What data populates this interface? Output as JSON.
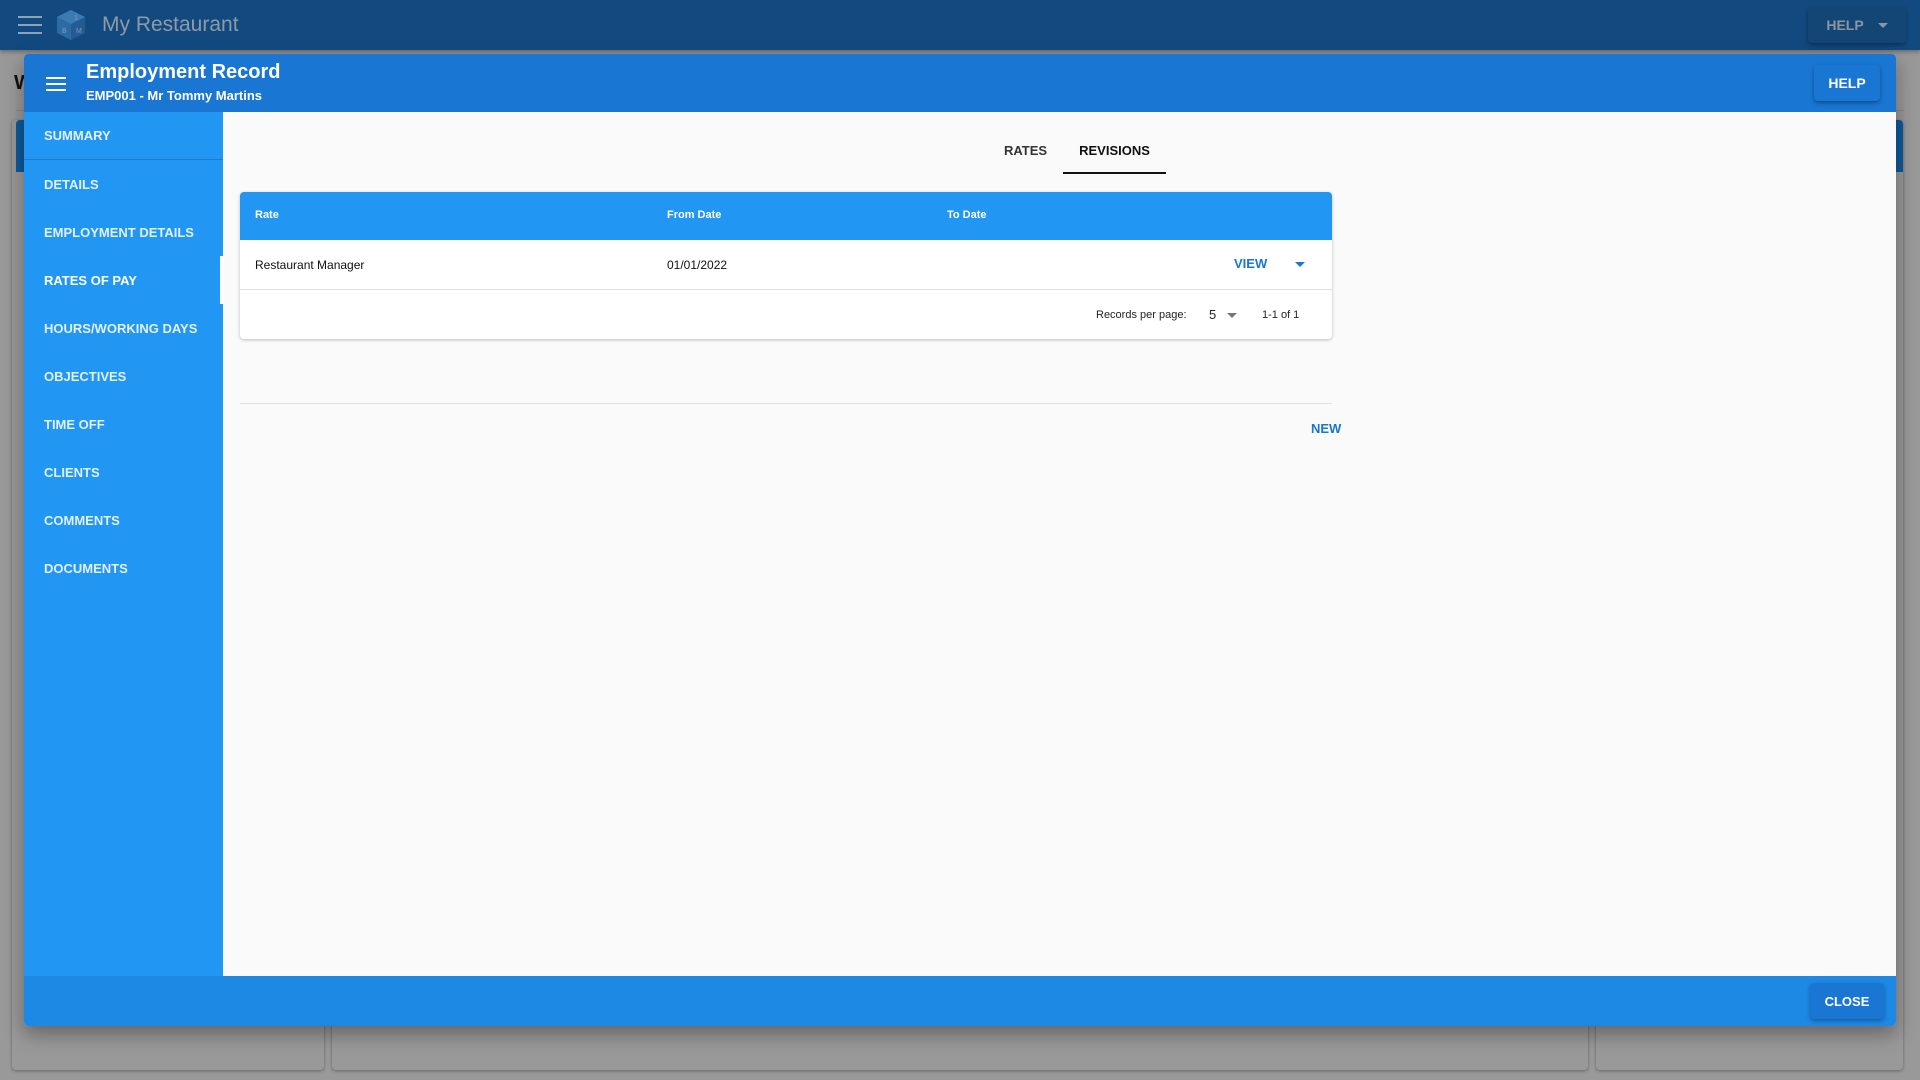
{
  "app": {
    "title": "My Restaurant",
    "help_label": "HELP",
    "background_heading": "W"
  },
  "dialog": {
    "title": "Employment Record",
    "subtitle": "EMP001 - Mr Tommy Martins",
    "help_label": "HELP",
    "close_label": "CLOSE"
  },
  "sidebar": {
    "active": "RATES OF PAY",
    "items": [
      {
        "label": "SUMMARY"
      },
      {
        "label": "DETAILS"
      },
      {
        "label": "EMPLOYMENT DETAILS"
      },
      {
        "label": "RATES OF PAY"
      },
      {
        "label": "HOURS/WORKING DAYS"
      },
      {
        "label": "OBJECTIVES"
      },
      {
        "label": "TIME OFF"
      },
      {
        "label": "CLIENTS"
      },
      {
        "label": "COMMENTS"
      },
      {
        "label": "DOCUMENTS"
      }
    ]
  },
  "tabs": {
    "active": "REVISIONS",
    "items": [
      {
        "label": "RATES"
      },
      {
        "label": "REVISIONS"
      }
    ]
  },
  "table": {
    "columns": [
      "Rate",
      "From Date",
      "To Date"
    ],
    "rows": [
      {
        "rate": "Restaurant Manager",
        "from_date": "01/01/2022",
        "to_date": "",
        "action_label": "VIEW"
      }
    ],
    "footer": {
      "records_per_page_label": "Records per page:",
      "records_per_page": "5",
      "range": "1-1 of 1"
    }
  },
  "new_label": "NEW",
  "colors": {
    "primary": "#1976d2",
    "sidebar": "#2196f3",
    "footer": "#1e88e5",
    "appbar": "#124a80"
  }
}
